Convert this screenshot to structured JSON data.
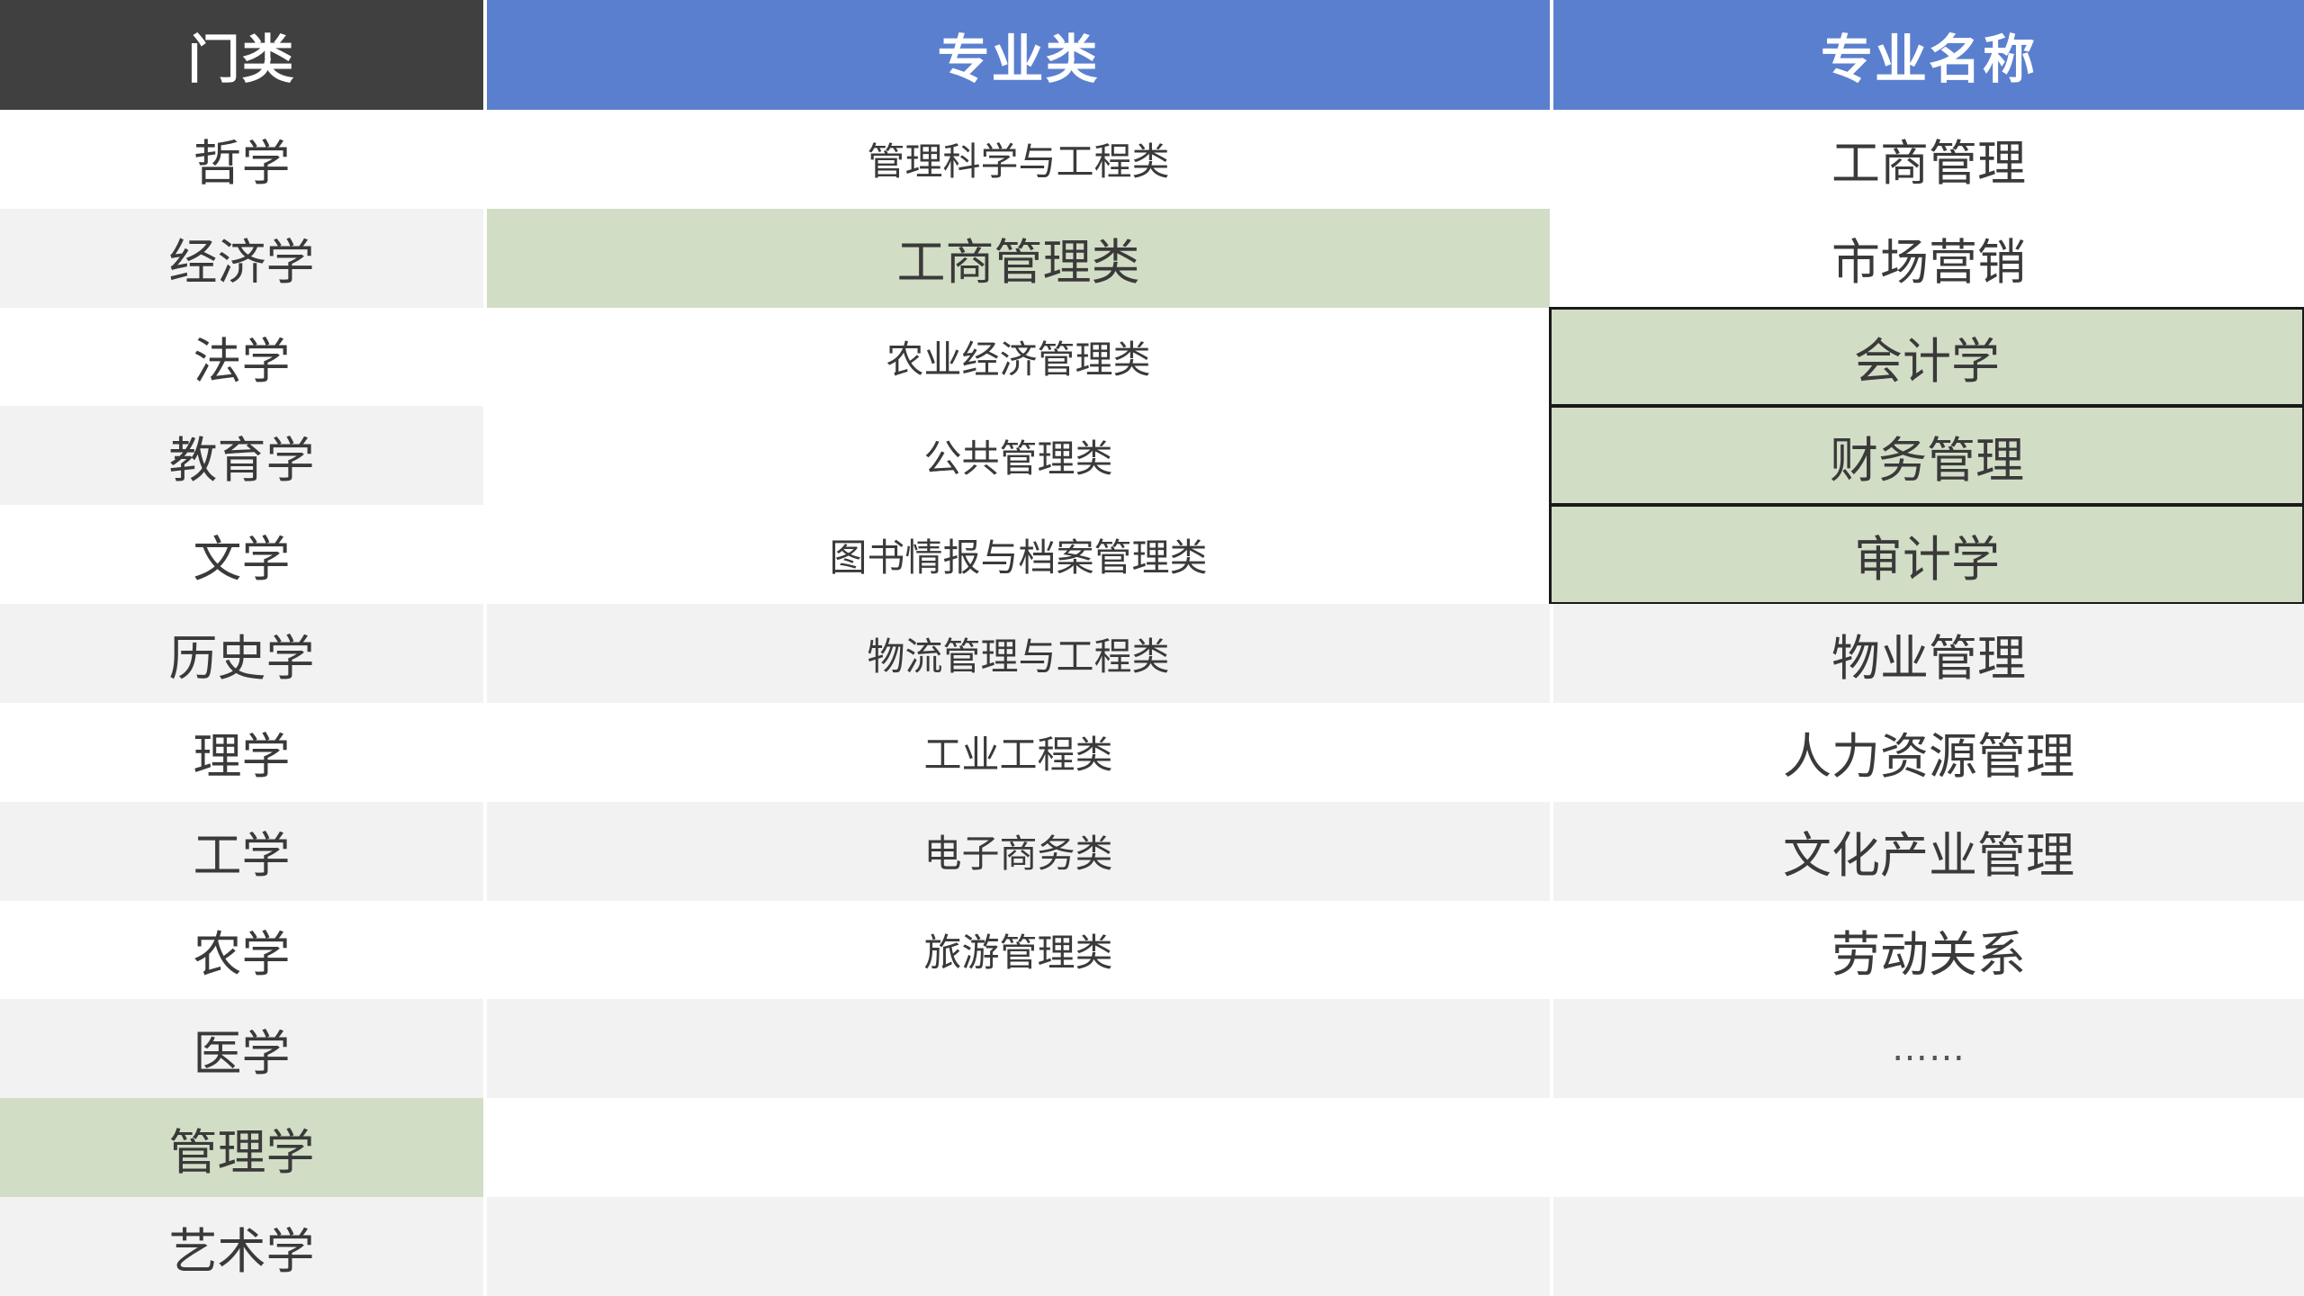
{
  "headers": {
    "category": "门类",
    "major_class": "专业类",
    "major_name": "专业名称"
  },
  "rows": [
    {
      "category": "哲学",
      "major_class": "管理科学与工程类",
      "major_name": "工商管理"
    },
    {
      "category": "经济学",
      "major_class": "工商管理类",
      "major_name": "市场营销"
    },
    {
      "category": "法学",
      "major_class": "农业经济管理类",
      "major_name": "会计学"
    },
    {
      "category": "教育学",
      "major_class": "公共管理类",
      "major_name": "财务管理"
    },
    {
      "category": "文学",
      "major_class": "图书情报与档案管理类",
      "major_name": "审计学"
    },
    {
      "category": "历史学",
      "major_class": "物流管理与工程类",
      "major_name": "物业管理"
    },
    {
      "category": "理学",
      "major_class": "工业工程类",
      "major_name": "人力资源管理"
    },
    {
      "category": "工学",
      "major_class": "电子商务类",
      "major_name": "文化产业管理"
    },
    {
      "category": "农学",
      "major_class": "旅游管理类",
      "major_name": "劳动关系"
    },
    {
      "category": "医学",
      "major_class": "",
      "major_name": "……"
    },
    {
      "category": "管理学",
      "major_class": "",
      "major_name": ""
    },
    {
      "category": "艺术学",
      "major_class": "",
      "major_name": ""
    }
  ],
  "colors": {
    "header_dark": "#404040",
    "header_blue": "#5b7fcf",
    "highlight": "#d2ddc6",
    "row_alt": "#f2f2f2"
  }
}
